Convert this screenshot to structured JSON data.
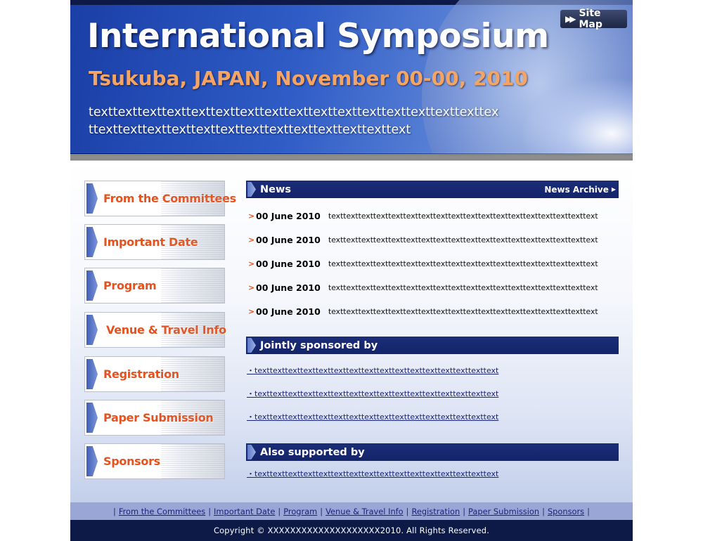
{
  "header": {
    "title": "International Symposium",
    "subtitle": "Tsukuba, JAPAN, November 00-00, 2010",
    "description": "texttexttexttexttexttexttexttexttexttexttexttexttexttexttexttexttexttexttexttexttexttexttexttexttexttexttexttexttexttext",
    "sitemap_label": "Site Map",
    "sitemap_icon": "fast-forward-icon"
  },
  "sidebar": {
    "items": [
      {
        "label": "From the Committees"
      },
      {
        "label": "Important Date"
      },
      {
        "label": "Program"
      },
      {
        "label": "Venue & Travel Info"
      },
      {
        "label": "Registration"
      },
      {
        "label": "Paper Submission"
      },
      {
        "label": "Sponsors"
      }
    ]
  },
  "news": {
    "heading": "News",
    "archive_label": "News Archive",
    "items": [
      {
        "date": "00 June 2010",
        "text": "texttexttexttexttexttexttexttexttexttexttexttexttexttexttexttexttexttext"
      },
      {
        "date": "00 June 2010",
        "text": "texttexttexttexttexttexttexttexttexttexttexttexttexttexttexttexttexttext"
      },
      {
        "date": "00 June 2010",
        "text": "texttexttexttexttexttexttexttexttexttexttexttexttexttexttexttexttexttext"
      },
      {
        "date": "00 June 2010",
        "text": "texttexttexttexttexttexttexttexttexttexttexttexttexttexttexttexttexttext"
      },
      {
        "date": "00 June 2010",
        "text": "texttexttexttexttexttexttexttexttexttexttexttexttexttexttexttexttexttext"
      }
    ]
  },
  "jointly": {
    "heading": "Jointly sponsored by",
    "links": [
      "・texttexttexttexttexttexttexttexttexttexttexttexttexttexttexttext",
      "・texttexttexttexttexttexttexttexttexttexttexttexttexttexttexttext",
      "・texttexttexttexttexttexttexttexttexttexttexttexttexttexttexttext"
    ]
  },
  "also": {
    "heading": "Also supported by",
    "links": [
      "・texttexttexttexttexttexttexttexttexttexttexttexttexttexttexttext"
    ]
  },
  "footer": {
    "links": [
      "From the Committees",
      "Important Date",
      "Program",
      "Venue & Travel Info",
      "Registration",
      "Paper Submission",
      "Sponsors"
    ],
    "separator": "|",
    "copyright": "Copyright © XXXXXXXXXXXXXXXXXXXX2010. All Rights Reserved."
  },
  "colors": {
    "navy": "#1b2d78",
    "accent_orange": "#e4531f",
    "subtitle_orange": "#f4a566",
    "footer_nav_bg": "#9aa6d6",
    "footer_bg": "#0d1a48"
  }
}
